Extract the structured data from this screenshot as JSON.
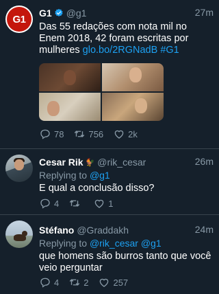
{
  "tweets": [
    {
      "name": "G1",
      "handle": "@g1",
      "time": "27m",
      "verified": true,
      "avatar_text": "G1",
      "text_parts": [
        "Das 55 redações com nota mil no Enem 2018, 42 foram escritas por mulheres ",
        "glo.bo/2RGNadB",
        " ",
        "#G1"
      ],
      "replies": "78",
      "retweets": "756",
      "likes": "2k"
    },
    {
      "name": "Cesar Rik",
      "emoji": "🐓",
      "handle": "@rik_cesar",
      "time": "26m",
      "replying_prefix": "Replying to ",
      "replying_to": "@g1",
      "text": "E qual a conclusão disso?",
      "replies": "4",
      "retweets": "",
      "likes": "1"
    },
    {
      "name": "Stéfano",
      "handle": "@Graddakh",
      "time": "24m",
      "replying_prefix": "Replying to ",
      "replying_to": "@rik_cesar @g1",
      "text": "que homens são burros tanto que você veio perguntar",
      "replies": "4",
      "retweets": "2",
      "likes": "257"
    }
  ],
  "colors": {
    "background": "#15202b",
    "secondary": "#8899a6",
    "link": "#1da1f2",
    "divider": "#38444d"
  }
}
